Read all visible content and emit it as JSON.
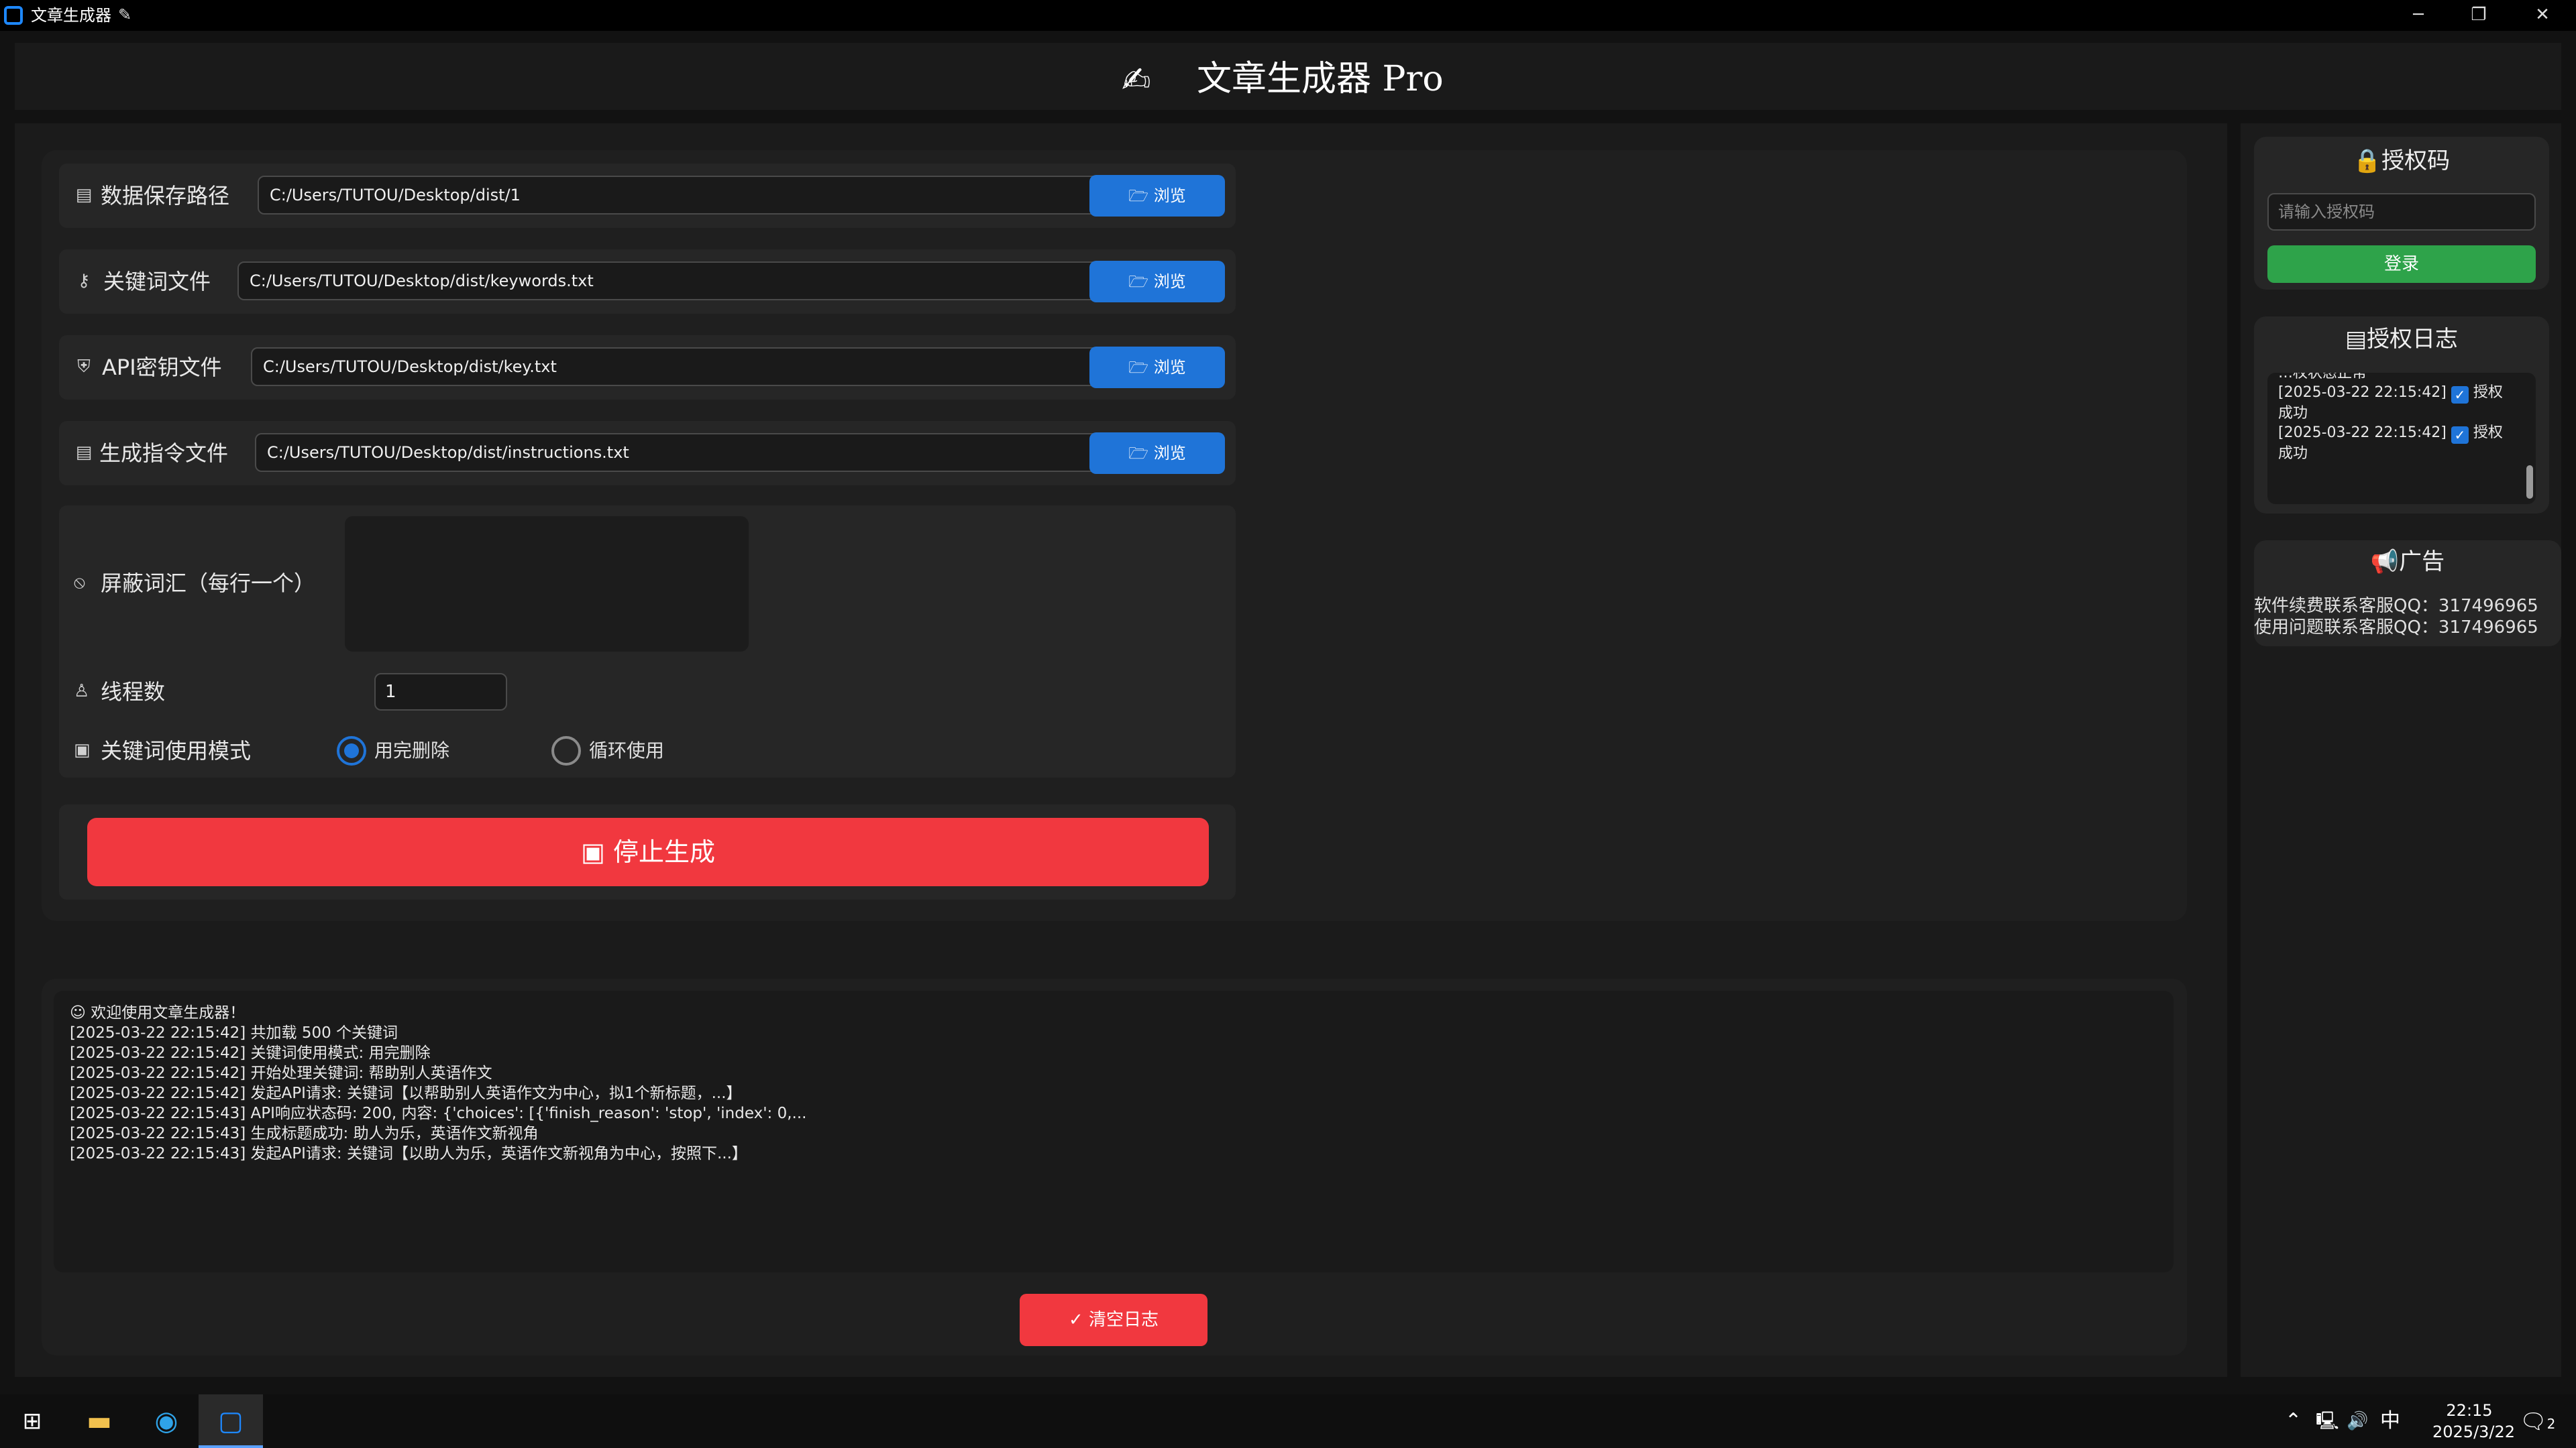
{
  "window": {
    "title": "文章生成器",
    "minimize": "─",
    "restore": "❐",
    "close": "✕"
  },
  "header": {
    "title": "文章生成器 Pro"
  },
  "form": {
    "rows": [
      {
        "label": "数据保存路径",
        "value": "C:/Users/TUTOU/Desktop/dist/1",
        "browse": "浏览"
      },
      {
        "label": "关键词文件",
        "value": "C:/Users/TUTOU/Desktop/dist/keywords.txt",
        "browse": "浏览"
      },
      {
        "label": "API密钥文件",
        "value": "C:/Users/TUTOU/Desktop/dist/key.txt",
        "browse": "浏览"
      },
      {
        "label": "生成指令文件",
        "value": "C:/Users/TUTOU/Desktop/dist/instructions.txt",
        "browse": "浏览"
      }
    ],
    "blocked_words_label": "屏蔽词汇（每行一个）",
    "blocked_words_value": "",
    "threads_label": "线程数",
    "threads_value": "1",
    "keyword_mode_label": "关键词使用模式",
    "mode_options": [
      "用完删除",
      "循环使用"
    ],
    "mode_selected": "用完删除",
    "stop_label": "停止生成"
  },
  "log": {
    "lines": [
      "欢迎使用文章生成器！",
      "[2025-03-22 22:15:42] 共加载 500 个关键词",
      "[2025-03-22 22:15:42] 关键词使用模式: 用完删除",
      "[2025-03-22 22:15:42] 开始处理关键词: 帮助别人英语作文",
      "[2025-03-22 22:15:42] 发起API请求: 关键词【以帮助别人英语作文为中心，拟1个新标题，...】",
      "[2025-03-22 22:15:43] API响应状态码: 200, 内容: {'choices': [{'finish_reason': 'stop', 'index': 0,...",
      "[2025-03-22 22:15:43] 生成标题成功: 助人为乐，英语作文新视角",
      "[2025-03-22 22:15:43] 发起API请求: 关键词【以助人为乐，英语作文新视角为中心，按照下...】"
    ],
    "clear_label": "清空日志"
  },
  "auth": {
    "title": "授权码",
    "placeholder": "请输入授权码",
    "login_label": "登录",
    "log_title": "授权日志",
    "log_partial": "…权状态正常",
    "log_entries": [
      {
        "time": "[2025-03-22 22:15:42]",
        "text": "授权",
        "cont": "成功"
      },
      {
        "time": "[2025-03-22 22:15:42]",
        "text": "授权",
        "cont": "成功"
      }
    ]
  },
  "ad": {
    "title": "广告",
    "lines": [
      "软件续费联系客服QQ：317496965",
      "使用问题联系客服QQ：317496965"
    ]
  },
  "taskbar": {
    "time": "22:15",
    "date": "2025/3/22",
    "ime": "中",
    "notifications": "2"
  },
  "colors": {
    "accent_blue": "#1f74d8",
    "danger_red": "#f1383f",
    "success_green": "#2ea34a"
  }
}
